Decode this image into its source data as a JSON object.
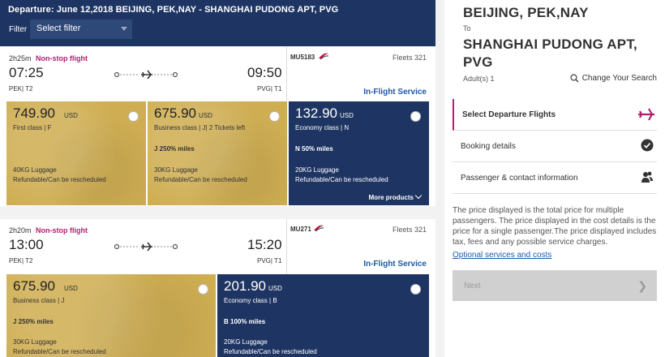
{
  "header": {
    "route": "Departure: June 12,2018 BEIJING, PEK,NAY - SHANGHAI PUDONG APT, PVG",
    "filter_label": "Filter",
    "filter_value": "Select filter"
  },
  "flights": [
    {
      "duration": "2h25m",
      "nonstop": "Non-stop flight",
      "dep_time": "07:25",
      "arr_time": "09:50",
      "dep_airport": "PEK| T2",
      "arr_airport": "PVG| T1",
      "flight_no": "MU5183",
      "fleet": "Fleets 321",
      "inflight": "In-Flight Service",
      "fares": [
        {
          "price": "749.90",
          "currency": "USD",
          "class": "First class | F",
          "miles": "",
          "luggage": "40KG Luggage",
          "refund": "Refundable/Can be rescheduled"
        },
        {
          "price": "675.90",
          "currency": "USD",
          "class": "Business class | J| 2 Tickets left",
          "miles": "J 250% miles",
          "luggage": "30KG Luggage",
          "refund": "Refundable/Can be rescheduled"
        },
        {
          "price": "132.90",
          "currency": "USD",
          "class": "Economy class | N",
          "miles": "N 50% miles",
          "luggage": "20KG Luggage",
          "refund": "Refundable/Can be rescheduled",
          "more": "More products"
        }
      ]
    },
    {
      "duration": "2h20m",
      "nonstop": "Non-stop flight",
      "dep_time": "13:00",
      "arr_time": "15:20",
      "dep_airport": "PEK| T2",
      "arr_airport": "PVG| T1",
      "flight_no": "MU271",
      "fleet": "Fleets 321",
      "inflight": "In-Flight Service",
      "fares": [
        {
          "price": "675.90",
          "currency": "USD",
          "class": "Business class | J",
          "miles": "J 250% miles",
          "luggage": "30KG Luggage",
          "refund": "Refundable/Can be rescheduled"
        },
        {
          "price": "201.90",
          "currency": "USD",
          "class": "Economy class | B",
          "miles": "B 100% miles",
          "luggage": "20KG Luggage",
          "refund": "Refundable/Can be rescheduled"
        }
      ]
    }
  ],
  "sidebar": {
    "from": "BEIJING, PEK,NAY",
    "to_label": "To",
    "to": "SHANGHAI PUDONG APT, PVG",
    "adults": "Adult(s) 1",
    "change_search": "Change Your Search",
    "steps": [
      {
        "label": "Select Departure Flights"
      },
      {
        "label": "Booking details"
      },
      {
        "label": "Passenger & contact information"
      }
    ],
    "notice": "The price displayed is the total price for multiple passengers. The price displayed in the cost details is the price for a single passenger.The price displayed includes tax, fees and any possible service charges.",
    "optional_link": "Optional services and costs",
    "next_label": "Next"
  },
  "colors": {
    "navy": "#1e3563",
    "gold": "#cfae53",
    "magenta": "#b11f70",
    "link_blue": "#1e5aa8"
  }
}
